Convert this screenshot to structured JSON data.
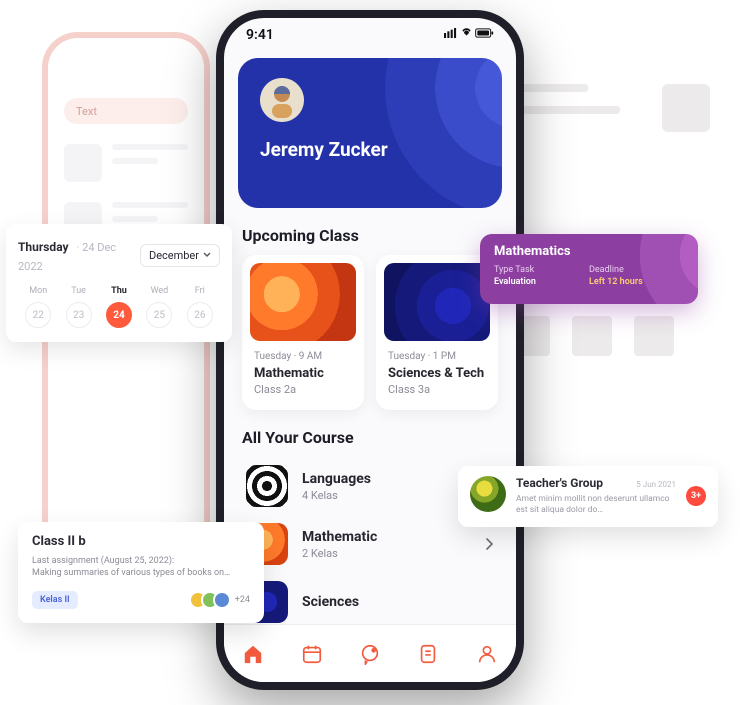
{
  "statusbar": {
    "time": "9:41"
  },
  "hero": {
    "name": "Jeremy Zucker"
  },
  "upcoming": {
    "heading": "Upcoming Class",
    "cards": [
      {
        "day": "Tuesday",
        "time": "9 AM",
        "title": "Mathematic",
        "klass": "Class 2a"
      },
      {
        "day": "Tuesday",
        "time": "1 PM",
        "title": "Sciences & Tech",
        "klass": "Class 3a"
      }
    ]
  },
  "courses": {
    "heading": "All Your Course",
    "items": [
      {
        "title": "Languages",
        "sub": "4 Kelas"
      },
      {
        "title": "Mathematic",
        "sub": "2 Kelas"
      },
      {
        "title": "Sciences",
        "sub": ""
      }
    ]
  },
  "ghost": {
    "search_placeholder": "Text"
  },
  "datecard": {
    "dayname": "Thursday",
    "date": "24 Dec 2022",
    "select": "December",
    "days": [
      {
        "w": "Mon",
        "n": "22"
      },
      {
        "w": "Tue",
        "n": "23"
      },
      {
        "w": "Thu",
        "n": "24",
        "active": true
      },
      {
        "w": "Wed",
        "n": "25"
      },
      {
        "w": "Fri",
        "n": "26"
      }
    ]
  },
  "purple": {
    "title": "Mathematics",
    "type_label": "Type Task",
    "type_value": "Evaluation",
    "deadline_label": "Deadline",
    "deadline_value": "Left 12 hours"
  },
  "assignment": {
    "title": "Class II b",
    "line1": "Last assignment (August 25, 2022):",
    "line2": "Making summaries of various types of books on…",
    "tag": "Kelas II",
    "more": "+24"
  },
  "teacher_group": {
    "name": "Teacher's Group",
    "date": "5 Jun 2021",
    "msg": "Amet minim mollit non deserunt ullamco est sit aliqua dolor do…",
    "badge": "3+"
  }
}
